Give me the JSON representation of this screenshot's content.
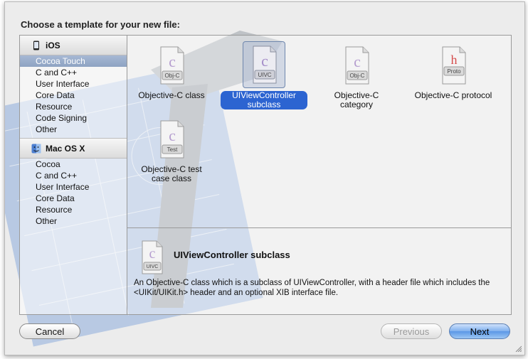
{
  "dialog": {
    "heading": "Choose a template for your new file:"
  },
  "sidebar": {
    "groups": [
      {
        "title": "iOS",
        "icon": "iphone-icon",
        "items": [
          "Cocoa Touch",
          "C and C++",
          "User Interface",
          "Core Data",
          "Resource",
          "Code Signing",
          "Other"
        ],
        "selected": "Cocoa Touch"
      },
      {
        "title": "Mac OS X",
        "icon": "finder-icon",
        "items": [
          "Cocoa",
          "C and C++",
          "User Interface",
          "Core Data",
          "Resource",
          "Other"
        ]
      }
    ]
  },
  "templates": [
    {
      "label": "Objective-C class",
      "badge": "Obj-C",
      "icon": "objc-class-file-icon"
    },
    {
      "label": "UIViewController subclass",
      "badge": "UIVC",
      "icon": "uivc-file-icon",
      "selected": true
    },
    {
      "label": "Objective-C category",
      "badge": "Obj-C",
      "icon": "objc-category-file-icon"
    },
    {
      "label": "Objective-C protocol",
      "badge": "Proto",
      "icon": "protocol-file-icon"
    },
    {
      "label": "Objective-C test case class",
      "badge": "Test",
      "icon": "test-case-file-icon"
    }
  ],
  "detail": {
    "title": "UIViewController subclass",
    "badge": "UIVC",
    "description": "An Objective-C class which is a subclass of UIViewController, with a header file which includes the <UIKit/UIKit.h> header and an optional XIB interface file."
  },
  "buttons": {
    "cancel": "Cancel",
    "previous": "Previous",
    "next": "Next"
  },
  "colors": {
    "selection": "#2c64d1",
    "sidebar_selection": "#98abc9"
  }
}
